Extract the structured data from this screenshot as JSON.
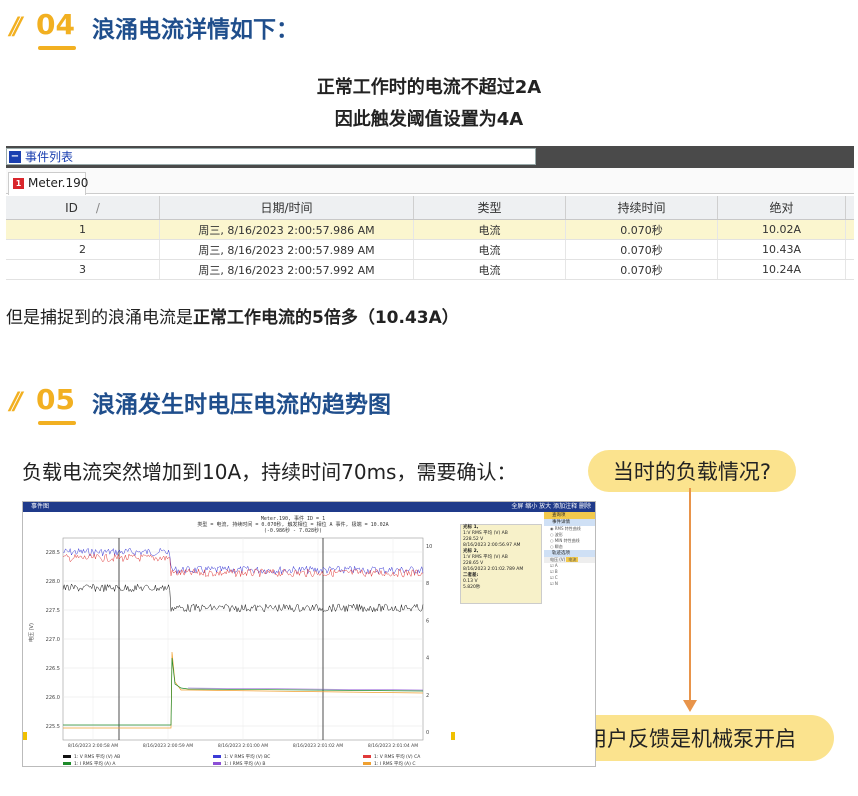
{
  "section04": {
    "num": "04",
    "title": "浪涌电流详情如下："
  },
  "intro_line1": "正常工作时的电流不超过2A",
  "intro_line2": "因此触发阈值设置为4A",
  "event_list": {
    "panel_title": "事件列表",
    "tab_label": "Meter.190",
    "tab_icon": "1",
    "columns": [
      "ID",
      "日期/时间",
      "类型",
      "持续时间",
      "绝对"
    ],
    "rows": [
      {
        "id": "1",
        "datetime": "周三, 8/16/2023 2:00:57.986 AM",
        "type": "电流",
        "duration": "0.070秒",
        "abs": "10.02A"
      },
      {
        "id": "2",
        "datetime": "周三, 8/16/2023 2:00:57.989 AM",
        "type": "电流",
        "duration": "0.070秒",
        "abs": "10.43A"
      },
      {
        "id": "3",
        "datetime": "周三, 8/16/2023 2:00:57.992 AM",
        "type": "电流",
        "duration": "0.070秒",
        "abs": "10.24A"
      }
    ],
    "selected_row": 0
  },
  "para": {
    "normal": "但是捕捉到的浪涌电流是",
    "bold": "正常工作电流的5倍多（10.43A）"
  },
  "section05": {
    "num": "05",
    "title": "浪涌发生时电压电流的趋势图"
  },
  "ask_text": "负载电流突然增加到10A，持续时间70ms，需要确认：",
  "bubble_question": "当时的负载情况?",
  "bubble_answer": "用户反馈是机械泵开启",
  "trend_window": {
    "title": "事件图",
    "tools": "全屏   缩小   放大   添加注释   删除",
    "header_line1": "Meter.190, 事件 ID = 1",
    "header_line2": "类型 = 电流, 持续时间 = 0.070秒, 触发相位 = 相位 A 事件, 极端 = 10.02A",
    "header_line3": "(-0.986秒 - 7.028秒)",
    "left_axis_label": "电压 (V)",
    "y_ticks_left": [
      "228.5",
      "228.0",
      "227.5",
      "227.0",
      "226.5",
      "226.0",
      "225.5"
    ],
    "y_ticks_right": [
      "10",
      "8",
      "6",
      "4",
      "2",
      "0"
    ],
    "x_ticks": [
      "8/16/2023 2:00:58 AM",
      "8/16/2023 2:00:59 AM",
      "8/16/2023 2:01:00 AM",
      "8/16/2023 2:01:02 AM",
      "8/16/2023 2:01:04 AM"
    ],
    "side_info": [
      "光标 1,",
      "1:V RMS 平均 (V) AB",
      "228.52 V",
      "8/16/2023 2:00:56.97 AM",
      "光标 2,",
      "1:V RMS 平均 (V) AB",
      "228.65 V",
      "8/16/2023 2:01:02.789 AM",
      "二者差:",
      "0.13 V",
      "5.820秒"
    ],
    "side_panel": {
      "h1": "查询项",
      "h2": "事件详情",
      "opt1": "RMS 特性曲线",
      "opt2": "波形",
      "opt3": "MIN 特性曲线",
      "opt4": "瞬态",
      "h3": "轨迹选项",
      "col1": "电压 (V)",
      "col2": "电流",
      "phases": [
        "A",
        "B",
        "C",
        "N"
      ]
    },
    "legend": [
      {
        "label": "1: V RMS 平均 (V) AB",
        "color": "#111111"
      },
      {
        "label": "1: V RMS 平均 (V) BC",
        "color": "#3b3bd6"
      },
      {
        "label": "1: V RMS 平均 (V) CA",
        "color": "#e03a3a"
      },
      {
        "label": "1: I RMS 平均 (A) A",
        "color": "#1d8a2a"
      },
      {
        "label": "1: I RMS 平均 (A) B",
        "color": "#8c4fd6"
      },
      {
        "label": "1: I RMS 平均 (A) C",
        "color": "#f0a030"
      }
    ]
  },
  "colors": {
    "accent": "#f2b021",
    "title_blue": "#1f4e8c",
    "bubble": "#fbe38e",
    "arrow": "#e8944a"
  }
}
